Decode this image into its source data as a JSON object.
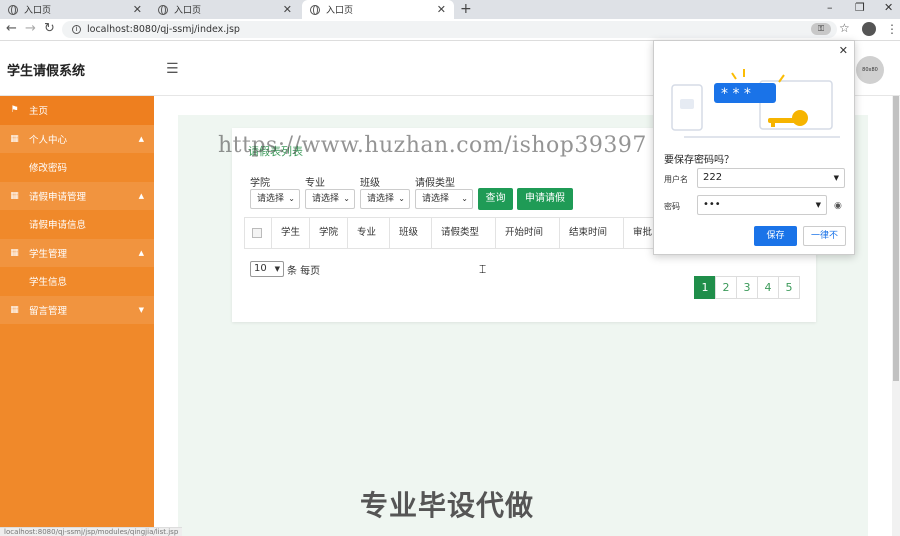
{
  "browser": {
    "tabs": [
      {
        "title": "入口页"
      },
      {
        "title": "入口页"
      },
      {
        "title": "入口页"
      }
    ],
    "url": "localhost:8080/qj-ssmj/index.jsp"
  },
  "header": {
    "title": "学生请假系统",
    "avatar_text": "80x80"
  },
  "sidebar": {
    "items": [
      {
        "label": "主页",
        "type": "top"
      },
      {
        "label": "个人中心",
        "type": "group"
      },
      {
        "label": "修改密码",
        "type": "sub"
      },
      {
        "label": "请假申请管理",
        "type": "group"
      },
      {
        "label": "请假申请信息",
        "type": "sub"
      },
      {
        "label": "学生管理",
        "type": "group"
      },
      {
        "label": "学生信息",
        "type": "sub"
      },
      {
        "label": "留言管理",
        "type": "group"
      }
    ]
  },
  "main": {
    "card_title": "请假表列表",
    "filters": [
      {
        "label": "学院",
        "value": "请选择"
      },
      {
        "label": "专业",
        "value": "请选择"
      },
      {
        "label": "班级",
        "value": "请选择"
      },
      {
        "label": "请假类型",
        "value": "请选择"
      }
    ],
    "buttons": {
      "query": "查询",
      "apply": "申请请假"
    },
    "table_headers": [
      "学生",
      "学院",
      "专业",
      "班级",
      "请假类型",
      "开始时间",
      "结束时间",
      "审批"
    ],
    "page_size": "10",
    "page_size_suffix": "条 每页",
    "pages": [
      "1",
      "2",
      "3",
      "4",
      "5"
    ],
    "current_page": "1"
  },
  "password_popup": {
    "title": "要保存密码吗？",
    "username_label": "用户名",
    "username_value": "222",
    "password_label": "密码",
    "password_value": "•••",
    "save_label": "保存",
    "never_label": "一律不"
  },
  "overlays": {
    "watermark": "https://www.huzhan.com/ishop39397",
    "banner": "专业毕设代做",
    "status_url": "localhost:8080/qj-ssmj/jsp/modules/qingjia/list.jsp"
  },
  "colors": {
    "sidebar": "#f0892a",
    "primary_green": "#1f9b56",
    "chrome_blue": "#1a73e8"
  }
}
